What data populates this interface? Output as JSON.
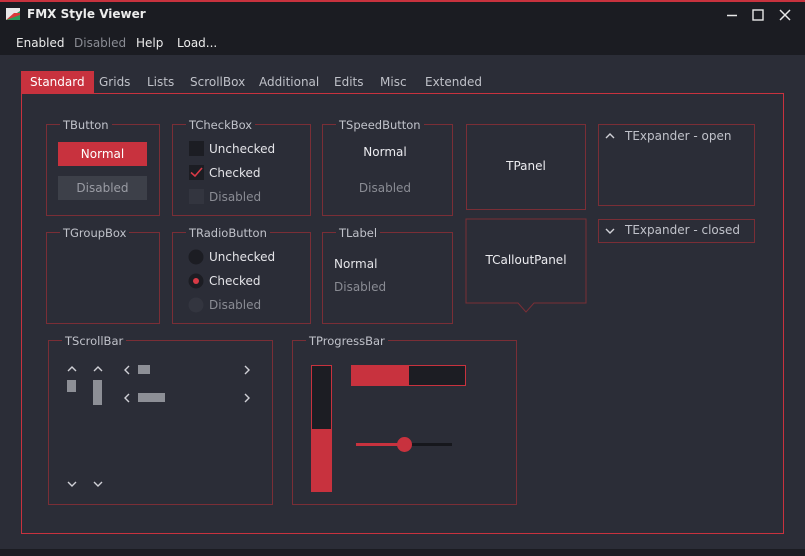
{
  "window": {
    "title": "FMX Style Viewer",
    "icon": "app-logo-icon"
  },
  "menu": [
    {
      "label": "Enabled",
      "enabled": true
    },
    {
      "label": "Disabled",
      "enabled": false
    },
    {
      "label": "Help",
      "enabled": true
    },
    {
      "label": "Load...",
      "enabled": true
    }
  ],
  "tabs": [
    "Standard",
    "Grids",
    "Lists",
    "ScrollBox",
    "Additional",
    "Edits",
    "Misc",
    "Extended"
  ],
  "active_tab": "Standard",
  "groups": {
    "tbutton": {
      "caption": "TButton",
      "normal": "Normal",
      "disabled": "Disabled"
    },
    "tcheckbox": {
      "caption": "TCheckBox",
      "unchecked": "Unchecked",
      "checked": "Checked",
      "disabled": "Disabled"
    },
    "tspeedbutton": {
      "caption": "TSpeedButton",
      "normal": "Normal",
      "disabled": "Disabled"
    },
    "tpanel": {
      "caption": "TPanel"
    },
    "texpander_open": {
      "caption": "TExpander - open"
    },
    "texpander_closed": {
      "caption": "TExpander - closed"
    },
    "tgroupbox": {
      "caption": "TGroupBox"
    },
    "tradiobutton": {
      "caption": "TRadioButton",
      "unchecked": "Unchecked",
      "checked": "Checked",
      "disabled": "Disabled"
    },
    "tlabel": {
      "caption": "TLabel",
      "normal": "Normal",
      "disabled": "Disabled"
    },
    "tcalloutpanel": {
      "caption": "TCalloutPanel"
    },
    "tscrollbar": {
      "caption": "TScrollBar"
    },
    "tprogressbar": {
      "caption": "TProgressBar",
      "horizontal_progress": 0.5,
      "vertical_progress": 0.5,
      "trackbar_value": 0.5
    }
  },
  "colors": {
    "accent": "#c8323e",
    "background": "#2b2d37",
    "titlebar": "#1b1c22",
    "disabled_text": "#8a8c94"
  }
}
